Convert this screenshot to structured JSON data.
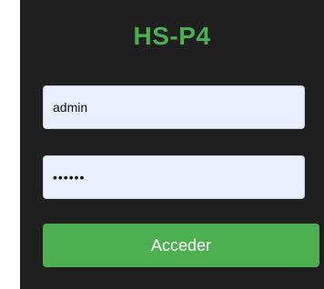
{
  "login": {
    "title": "HS-P4",
    "username_value": "admin",
    "password_value": "passwd",
    "submit_label": "Acceder"
  },
  "colors": {
    "accent": "#4caf50",
    "panel_background": "#1f1f1f",
    "field_background": "#e8f0fe"
  }
}
